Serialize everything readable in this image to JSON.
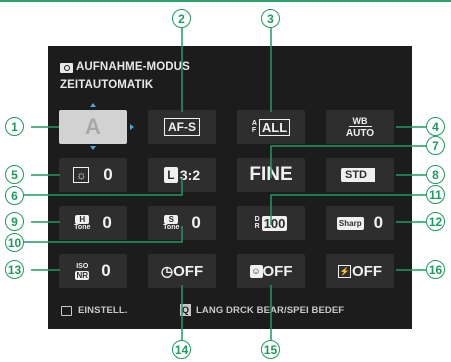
{
  "header": {
    "line1": "AUFNAHME-MODUS",
    "line2": "ZEITAUTOMATIK"
  },
  "menu": {
    "mode_letter": "A",
    "af_mode": "AF-S",
    "af_area": "ALL",
    "wb_label": "WB",
    "wb_value": "AUTO",
    "exposure_value": "0",
    "image_size": "3:2",
    "image_quality": "FINE",
    "film_sim": "STD",
    "highlight_tone": "0",
    "shadow_tone": "0",
    "dynamic_range": "100",
    "sharpness_label": "Sharp",
    "sharpness": "0",
    "nr_value": "0",
    "self_timer": "OFF",
    "face_detect": "OFF",
    "flash": "OFF"
  },
  "footer": {
    "settings": "EINSTELL.",
    "hint": "LANG DRCK BEAR/SPEI BEDEF"
  },
  "callouts": [
    "1",
    "2",
    "3",
    "4",
    "5",
    "6",
    "7",
    "8",
    "9",
    "10",
    "11",
    "12",
    "13",
    "14",
    "15",
    "16"
  ],
  "colors": {
    "accent": "#1f9a60",
    "screen": "#1c1c1c",
    "cell": "#2e2e2e"
  }
}
